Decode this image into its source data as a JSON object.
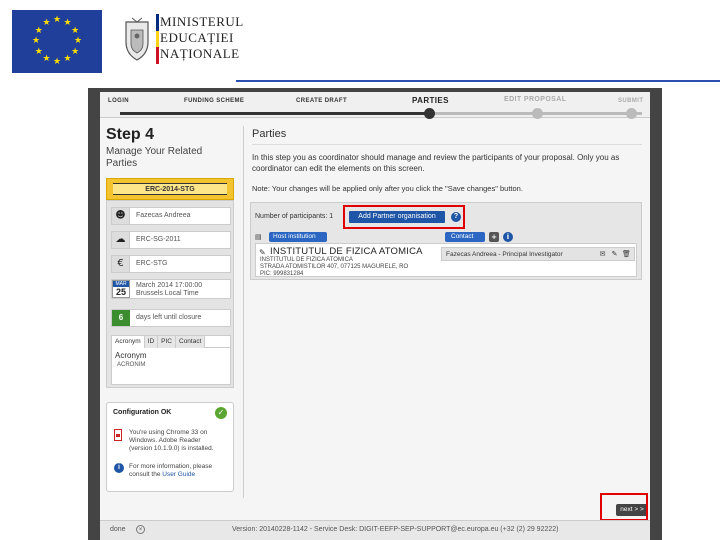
{
  "header": {
    "ministry_lines": [
      "MINISTERUL",
      "EDUCAȚIEI",
      "NAȚIONALE"
    ],
    "tricolor": [
      "#002b7f",
      "#fcd116",
      "#ce1126"
    ],
    "eu_blue": "#1f3f9a",
    "rule_color": "#2a4fb0"
  },
  "wizard": {
    "steps": [
      "LOGIN",
      "FUNDING SCHEME",
      "CREATE DRAFT",
      "PARTIES",
      "EDIT PROPOSAL",
      "SUBMIT"
    ],
    "active_step": "PARTIES"
  },
  "left": {
    "step_title": "Step 4",
    "step_sub": "Manage Your Related Parties",
    "call": "ERC-2014-STG",
    "person": "Fazecas Andreea",
    "scheme": "ERC-SG-2011",
    "funding": "ERC-STG",
    "date_month": "MAR",
    "date_day": "25",
    "deadline": "March 2014 17:00:00",
    "timezone": "Brussels Local Time",
    "days_count": "6",
    "days_left": "days left until closure",
    "tabs": [
      "Acronym",
      "ID",
      "PIC",
      "Contact"
    ],
    "acronym_label": "Acronym",
    "acronym_value": "ACRONIM"
  },
  "config": {
    "title": "Configuration OK",
    "text1": "You're using Chrome 33 on Windows. Adobe Reader (version 10.1.9.0) is installed.",
    "text2_prefix": "For more information, please consult the",
    "text2_link": "User Guide"
  },
  "parties": {
    "title": "Parties",
    "description": "In this step you as coordinator should manage and review the participants of your proposal. Only you as coordinator can edit the elements on this screen.",
    "note": "Note: Your changes will be applied only after you click the \"Save changes\" button.",
    "participants_label": "Number of participants: 1",
    "add_button": "Add Partner organisation",
    "help": "?",
    "host_badge": "Host institution",
    "org_name": "INSTITUTUL DE FIZICA ATOMICA",
    "org_line1": "INSTITUTUL DE FIZICA ATOMICA",
    "org_line2": "STRADA ATOMISTILOR 407, 077125 MAGURELE, RO",
    "org_pic": "PIC: 999831284",
    "contact_badge": "Contact",
    "contact_name": "Fazecas Andreea - Principal Investigator"
  },
  "footer": {
    "next_label": "next > >",
    "done": "done",
    "version": "Version: 20140228-1142 - Service Desk: DIGIT-EEFP-SEP-SUPPORT@ec.europa.eu (+32 (2) 29 92222)"
  },
  "colors": {
    "accent_blue": "#1f55a6",
    "highlight_red": "#e00000",
    "call_yellow": "#f4c430"
  }
}
